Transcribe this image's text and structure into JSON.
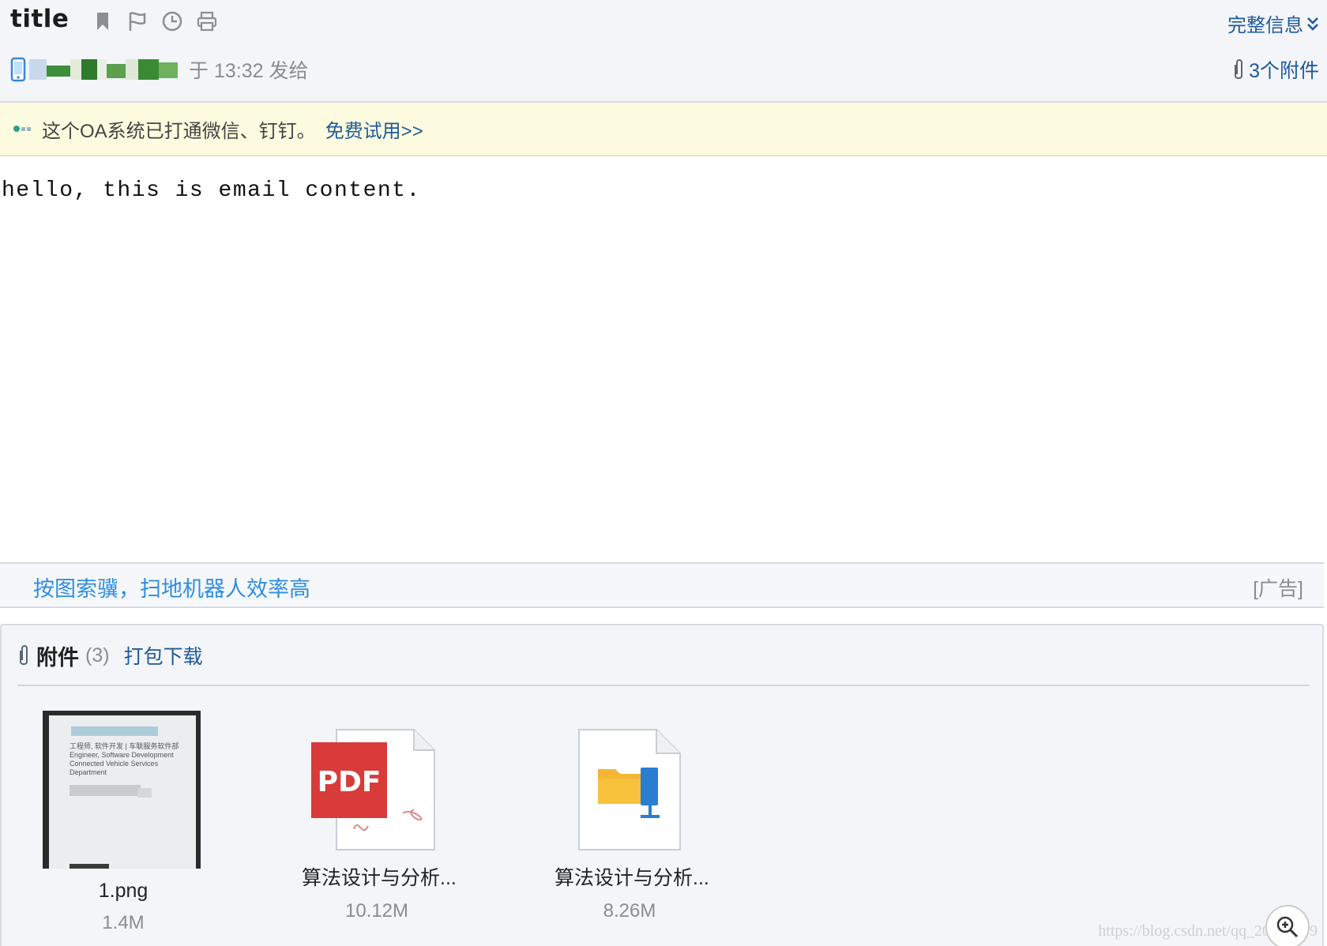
{
  "header": {
    "title": "title",
    "icons": [
      "bookmark-icon",
      "flag-icon",
      "clock-icon",
      "print-icon"
    ],
    "full_info": "完整信息",
    "sender": {
      "icon": "phone-icon",
      "sent_time": "于 13:32 发给"
    },
    "attachments_link": "3个附件"
  },
  "ad_bar": {
    "text": "这个OA系统已打通微信、钉钉。",
    "link": "免费试用>>"
  },
  "email": {
    "body": "hello, this is email content."
  },
  "promo": {
    "text": "按图索骥，扫地机器人效率高",
    "tag": "[广告]"
  },
  "attachments": {
    "title": "附件",
    "count": "(3)",
    "download_all": "打包下载",
    "files": [
      {
        "name": "1.png",
        "size": "1.4M",
        "type": "image"
      },
      {
        "name": "算法设计与分析...",
        "size": "10.12M",
        "type": "pdf"
      },
      {
        "name": "算法设计与分析...",
        "size": "8.26M",
        "type": "folder"
      }
    ],
    "thumb_lines": [
      "工程师, 软件开发 | 车联服务软件部",
      "Engineer, Software Development",
      "Connected Vehicle Services",
      "Department"
    ]
  },
  "footer": {
    "watermark": "https://blog.csdn.net/qq_20473499"
  },
  "colors": {
    "link": "#1f5a9a",
    "promo_link": "#2f8ee0",
    "ad_background": "#fdfbdf",
    "pdf_red": "#d93b3b"
  }
}
